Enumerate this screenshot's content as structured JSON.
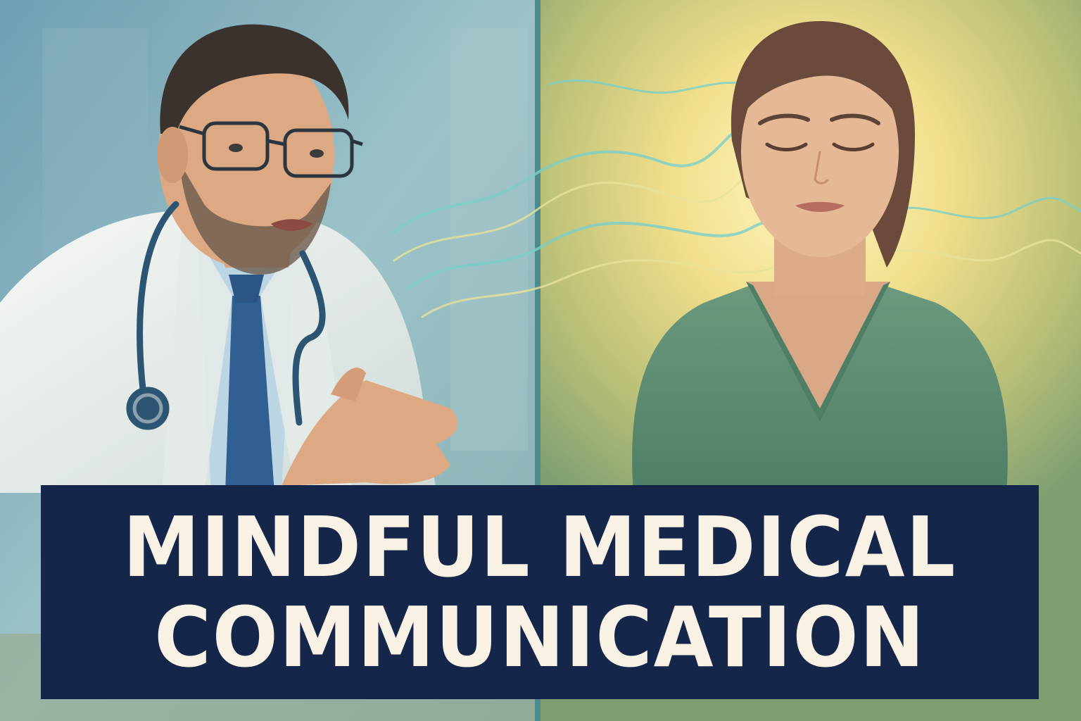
{
  "title": {
    "line1": "MINDFUL MEDICAL",
    "line2": "COMMUNICATION"
  },
  "palette": {
    "left_panel": "#8fb9c3",
    "right_panel": "#c9c47a",
    "halo": "#fbeaa0",
    "banner": "#15264a",
    "banner_text": "#f7f2e3",
    "lab_coat": "#eef1ee",
    "tie": "#2f5f93",
    "sweater": "#5f8f73",
    "waves": "#7ccfc8"
  },
  "figures": [
    "doctor",
    "patient"
  ],
  "icons": [
    "stethoscope-icon",
    "glasses-icon"
  ]
}
